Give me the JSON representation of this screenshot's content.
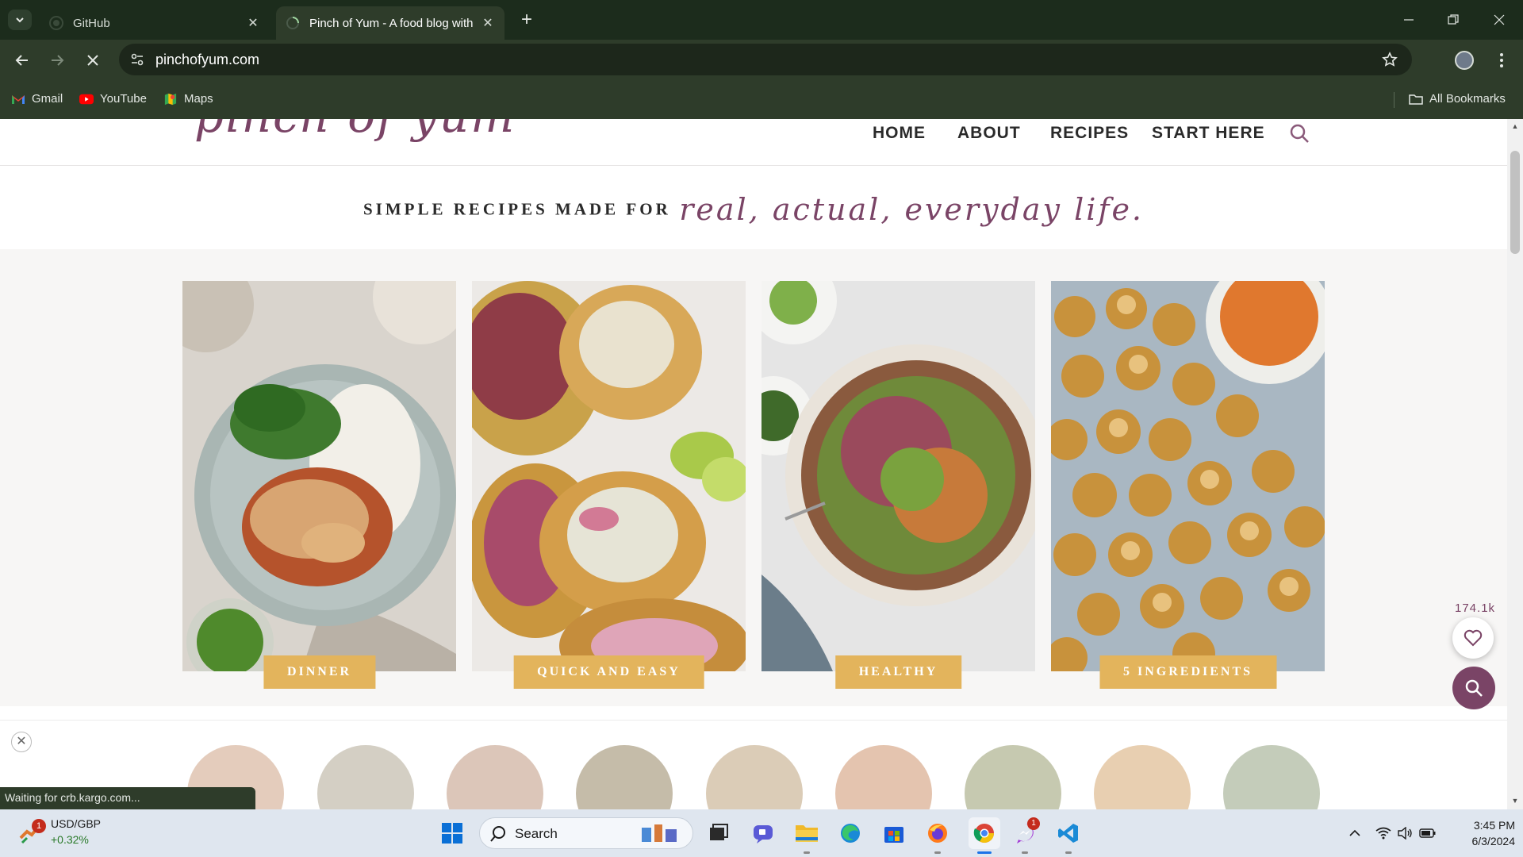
{
  "browser": {
    "tabs": [
      {
        "title": "GitHub",
        "active": false
      },
      {
        "title": "Pinch of Yum - A food blog with",
        "active": true
      }
    ],
    "url": "pinchofyum.com",
    "bookmarks": [
      {
        "label": "Gmail",
        "icon": "gmail-icon"
      },
      {
        "label": "YouTube",
        "icon": "youtube-icon"
      },
      {
        "label": "Maps",
        "icon": "maps-icon"
      }
    ],
    "all_bookmarks": "All Bookmarks",
    "status_text": "Waiting for crb.kargo.com..."
  },
  "site": {
    "logo_text": "pinch of yum",
    "nav": [
      {
        "label": "HOME"
      },
      {
        "label": "ABOUT"
      },
      {
        "label": "RECIPES"
      },
      {
        "label": "START HERE"
      }
    ],
    "tagline_caps": "SIMPLE RECIPES MADE FOR",
    "tagline_script": "real, actual, everyday life.",
    "categories": [
      {
        "label": "DINNER",
        "photo": "dinner-photo"
      },
      {
        "label": "QUICK AND EASY",
        "photo": "quick-and-easy-photo"
      },
      {
        "label": "HEALTHY",
        "photo": "healthy-photo"
      },
      {
        "label": "5 INGREDIENTS",
        "photo": "5-ingredients-photo"
      }
    ],
    "favorites_count": "174.1k"
  },
  "taskbar": {
    "stock_name": "USD/GBP",
    "stock_change": "+0.32%",
    "stock_badge": "1",
    "search_placeholder": "Search",
    "messenger_badge": "1",
    "time": "3:45 PM",
    "date": "6/3/2024"
  },
  "colors": {
    "brand_plum": "#7a4466",
    "category_button": "#e3b45c",
    "chrome_dark_green": "#2e3c2a",
    "tabbar_green": "#1c2c1c"
  }
}
